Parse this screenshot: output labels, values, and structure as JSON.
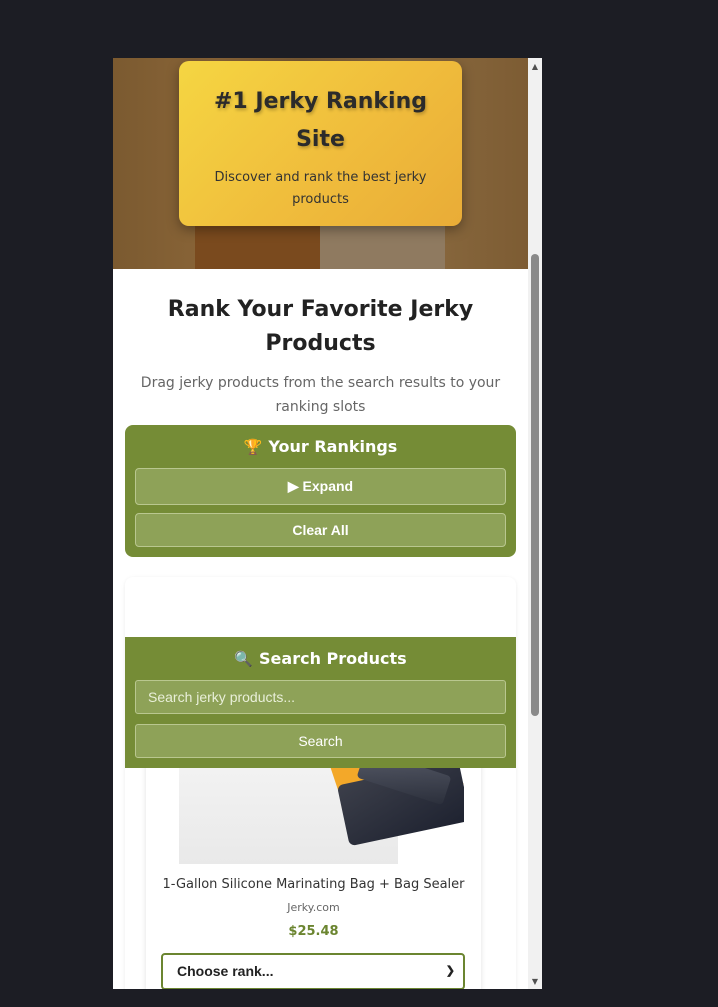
{
  "hero": {
    "title": "#1 Jerky Ranking Site",
    "subtitle": "Discover and rank the best jerky products"
  },
  "intro": {
    "title": "Rank Your Favorite Jerky Products",
    "description": "Drag jerky products from the search results to your ranking slots"
  },
  "rankings": {
    "icon": "trophy-icon",
    "icon_glyph": "🏆",
    "title": "Your Rankings",
    "expand_label": "▶ Expand",
    "clear_label": "Clear All"
  },
  "search": {
    "icon": "magnifier-icon",
    "icon_glyph": "🔍",
    "title": "Search Products",
    "placeholder": "Search jerky products...",
    "button_label": "Search"
  },
  "product": {
    "name": "1-Gallon Silicone Marinating Bag + Bag Sealer",
    "vendor": "Jerky.com",
    "price": "$25.48",
    "rank_select_value": "Choose rank..."
  },
  "scrollbar": {
    "up_glyph": "▲",
    "down_glyph": "▼"
  },
  "colors": {
    "accent_green": "#758c36",
    "price_green": "#6b8530",
    "hero_gold": "#f0bd3c"
  }
}
